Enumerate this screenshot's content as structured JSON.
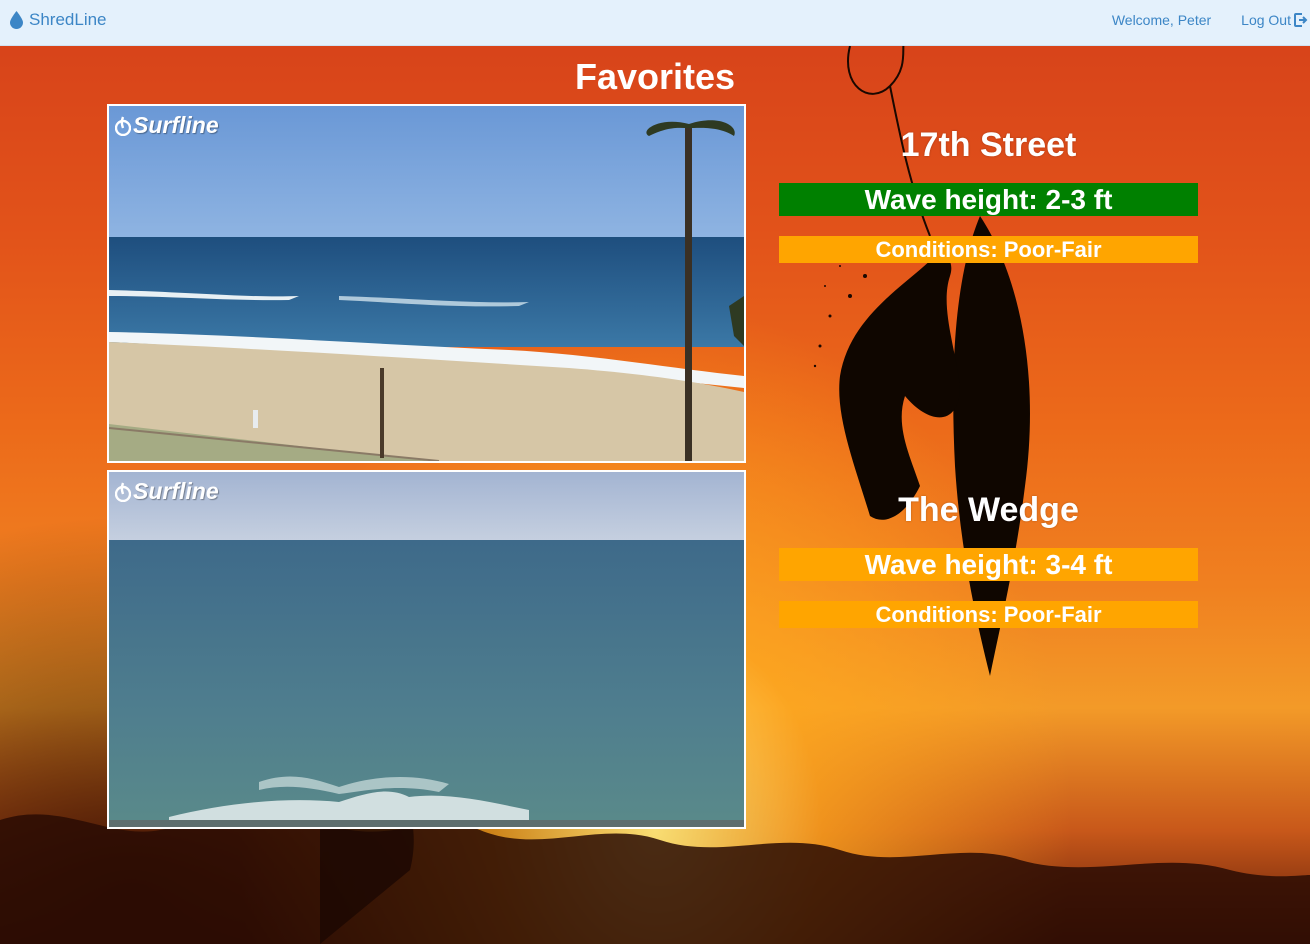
{
  "navbar": {
    "brand": "ShredLine",
    "brand_icon": "droplet-icon",
    "welcome": "Welcome, Peter",
    "logout": "Log Out",
    "logout_icon": "logout-icon",
    "color": "#3c86c6",
    "background": "#e4f1fc"
  },
  "page": {
    "title": "Favorites"
  },
  "favorites": [
    {
      "cam_logo": "Surfline",
      "name": "17th Street",
      "wave_height": "Wave height: 2-3 ft",
      "wave_color": "#008000",
      "conditions": "Conditions: Poor-Fair",
      "conditions_color": "#ffa500"
    },
    {
      "cam_logo": "Surfline",
      "name": "The Wedge",
      "wave_height": "Wave height: 3-4 ft",
      "wave_color": "#ffa500",
      "conditions": "Conditions: Poor-Fair",
      "conditions_color": "#ffa500"
    }
  ]
}
